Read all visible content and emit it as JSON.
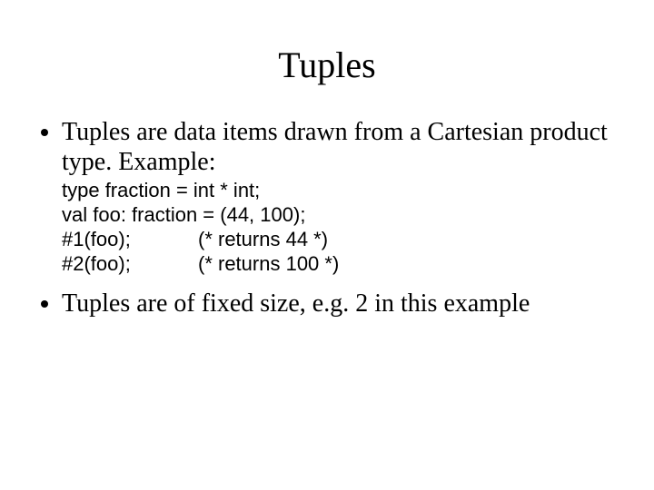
{
  "title": "Tuples",
  "bullets": {
    "b1": "Tuples are data items drawn from a Cartesian product type.  Example:",
    "b2": "Tuples are of fixed size, e.g. 2 in this example"
  },
  "code": {
    "l1": "type fraction = int * int;",
    "l2": "val foo: fraction = (44, 100);",
    "l3a": "#1(foo);",
    "l3b": "(* returns 44 *)",
    "l4a": "#2(foo);",
    "l4b": "(* returns 100 *)"
  }
}
